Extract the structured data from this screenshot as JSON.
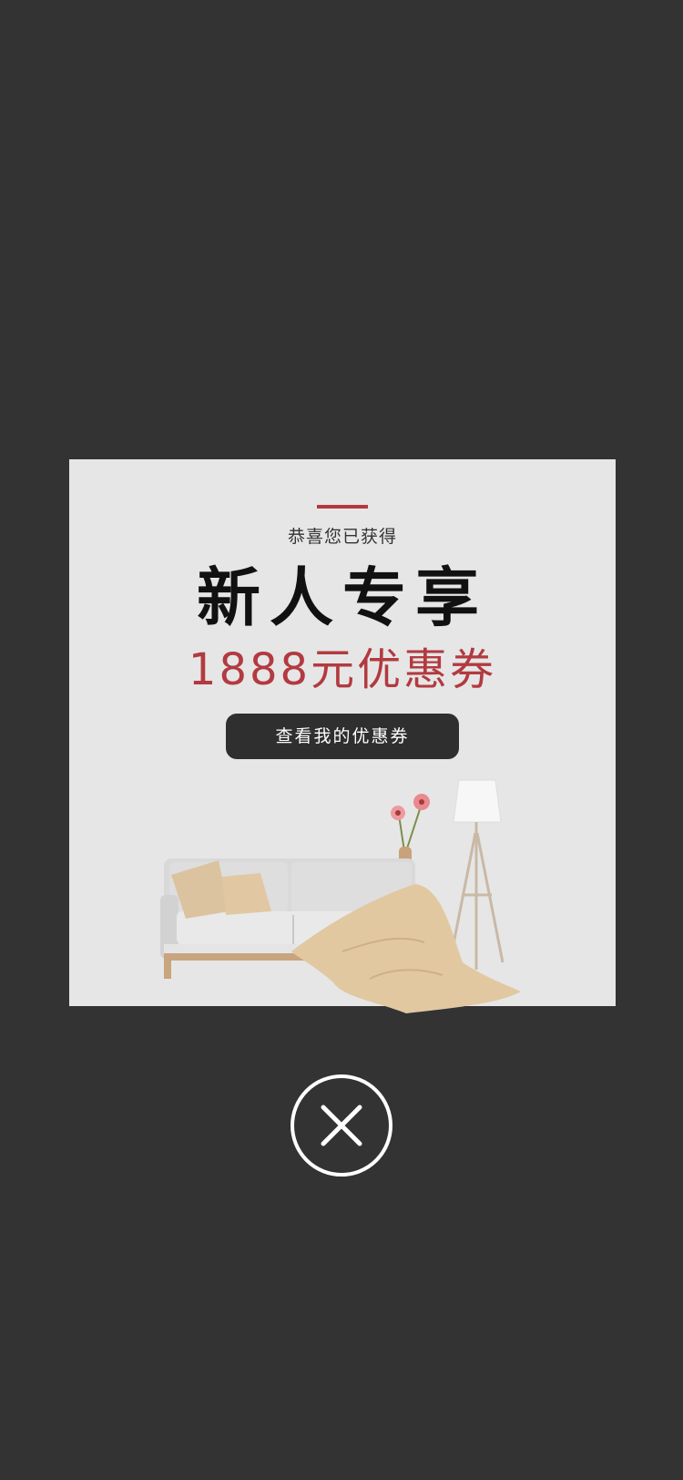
{
  "popup": {
    "subtitle": "恭喜您已获得",
    "title": "新人专享",
    "coupon": "1888元优惠券",
    "cta_label": "查看我的优惠券",
    "illustration": "living-room-sofa-lamp"
  },
  "close": {
    "icon": "close-icon"
  },
  "colors": {
    "overlay": "#333333",
    "card": "#e6e6e6",
    "accent": "#b5383f",
    "coupon_text": "#b23a40",
    "button": "#2f2f2f",
    "button_text": "#ffffff"
  }
}
